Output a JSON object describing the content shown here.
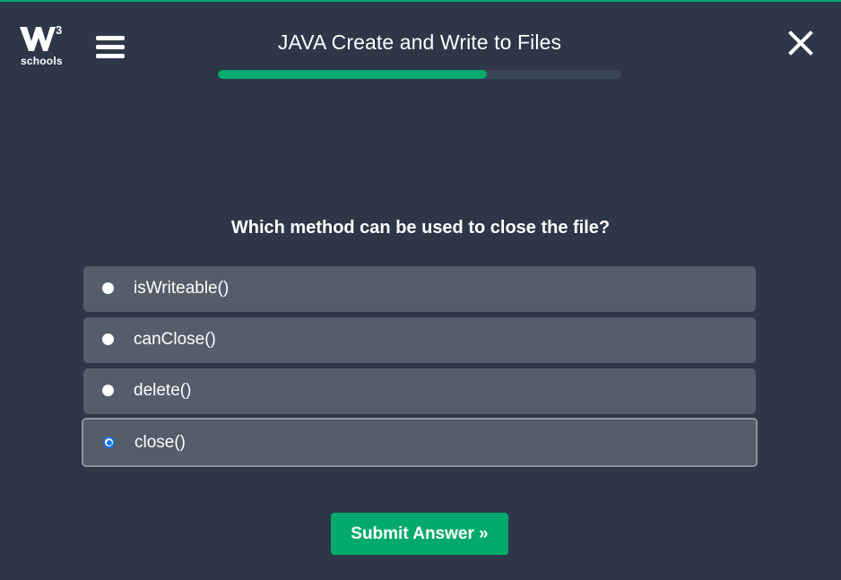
{
  "app": {
    "logo_text": "schools",
    "logo_superscript": "3",
    "accent_color": "#04aa6d",
    "background_color": "#2d3748"
  },
  "header": {
    "title": "JAVA Create and Write to Files",
    "menu_icon": "hamburger-menu-icon",
    "close_icon": "close-icon",
    "progress_fraction": 0.667
  },
  "quiz": {
    "question": "Which method can be used to close the file?",
    "options": [
      {
        "label": "isWriteable()",
        "selected": false
      },
      {
        "label": "canClose()",
        "selected": false
      },
      {
        "label": "delete()",
        "selected": false
      },
      {
        "label": "close()",
        "selected": true
      }
    ],
    "submit_label": "Submit Answer »"
  }
}
